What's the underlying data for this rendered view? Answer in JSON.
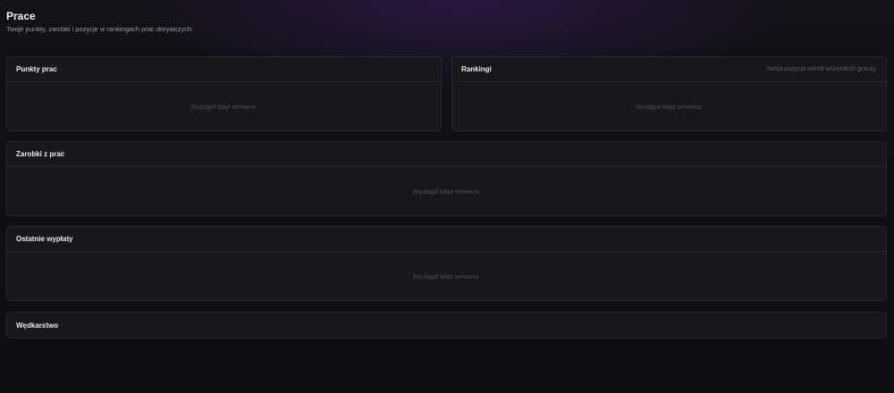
{
  "page": {
    "title": "Prace",
    "subtitle": "Twoje punkty, zarobki i pozycje w rankingach prac dorywczych."
  },
  "cards": {
    "punkty": {
      "title": "Punkty prac",
      "error": "Wystąpił błąd serwera."
    },
    "rankingi": {
      "title": "Rankingi",
      "hint": "Twoja pozycja wśród wszystkich graczy.",
      "error": "Wystąpił błąd serwera."
    },
    "zarobki": {
      "title": "Zarobki z prac",
      "error": "Wystąpił błąd serwera."
    },
    "wyplaty": {
      "title": "Ostatnie wypłaty",
      "error": "Wystąpił błąd serwera."
    },
    "wedkarstwo": {
      "title": "Wędkarstwo"
    }
  }
}
